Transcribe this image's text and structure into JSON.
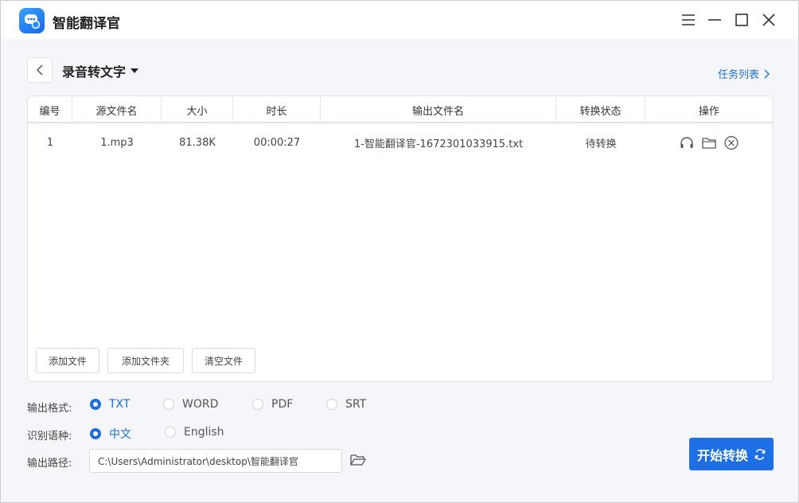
{
  "app": {
    "title": "智能翻译官"
  },
  "header": {
    "page_title": "录音转文字",
    "task_list_label": "任务列表"
  },
  "table": {
    "columns": [
      "编号",
      "源文件名",
      "大小",
      "时长",
      "输出文件名",
      "转换状态",
      "操作"
    ],
    "rows": [
      {
        "index": "1",
        "source": "1.mp3",
        "size": "81.38K",
        "duration": "00:00:27",
        "output": "1-智能翻译官-1672301033915.txt",
        "status": "待转换"
      }
    ]
  },
  "panel_buttons": {
    "add_file": "添加文件",
    "add_folder": "添加文件夹",
    "clear_files": "清空文件"
  },
  "options": {
    "format_label": "输出格式:",
    "formats": [
      "TXT",
      "WORD",
      "PDF",
      "SRT"
    ],
    "selected_format": "TXT",
    "language_label": "识别语种:",
    "languages": [
      "中文",
      "English"
    ],
    "selected_language": "中文",
    "path_label": "输出路径:",
    "path_value": "C:\\Users\\Administrator\\desktop\\智能翻译官"
  },
  "actions": {
    "start_label": "开始转换"
  },
  "colors": {
    "accent": "#1e6fe6",
    "link": "#1e6fd9"
  }
}
